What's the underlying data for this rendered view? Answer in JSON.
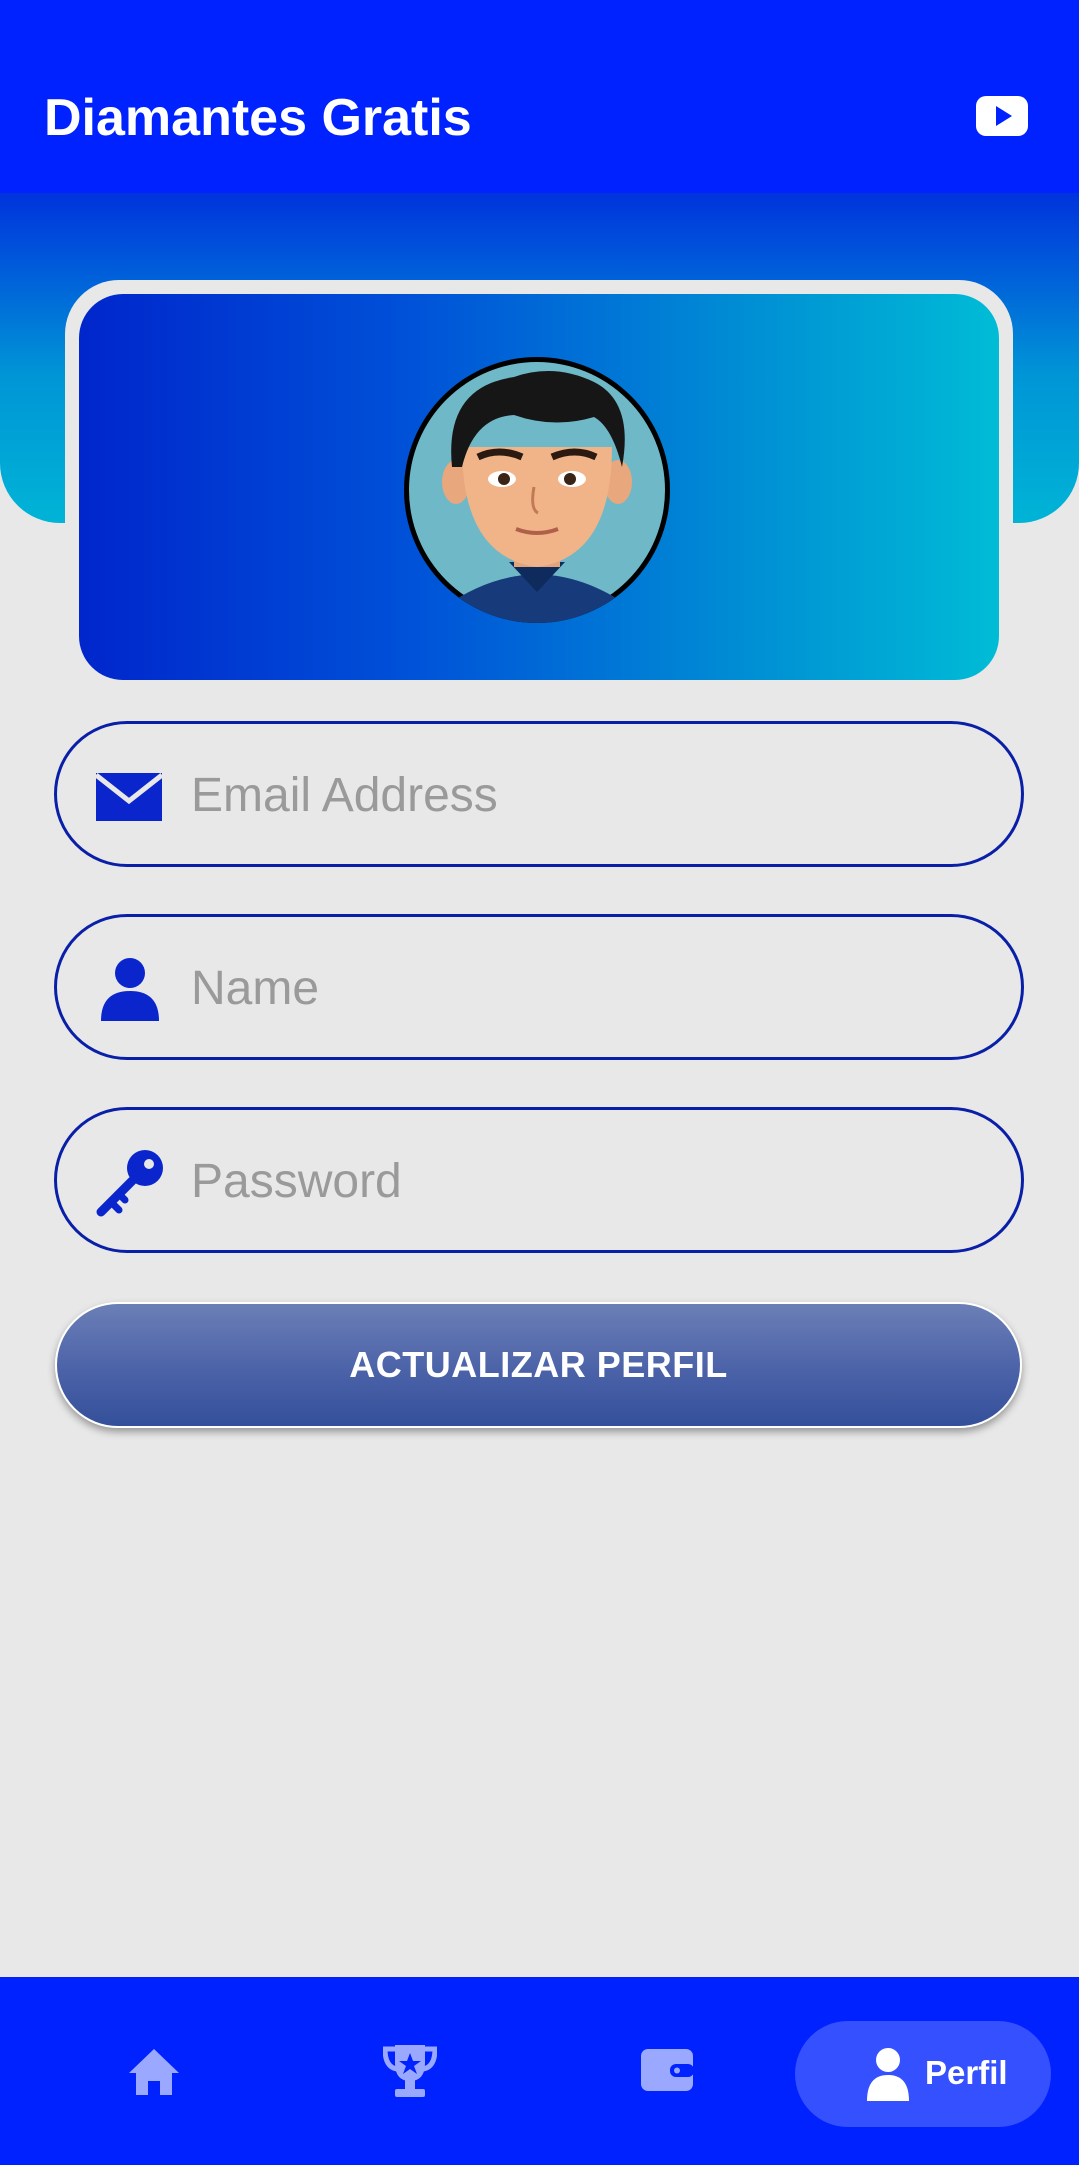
{
  "app": {
    "title": "Diamantes Gratis",
    "header_icon": "youtube-icon"
  },
  "profile": {
    "avatar_icon": "cartoon-avatar"
  },
  "form": {
    "email": {
      "placeholder": "Email Address",
      "value": "",
      "icon": "envelope-icon"
    },
    "name": {
      "placeholder": "Name",
      "value": "",
      "icon": "user-icon"
    },
    "password": {
      "placeholder": "Password",
      "value": "",
      "icon": "key-icon"
    },
    "submit_label": "ACTUALIZAR PERFIL"
  },
  "bottom_nav": {
    "items": [
      {
        "icon": "home-icon"
      },
      {
        "icon": "trophy-icon"
      },
      {
        "icon": "wallet-icon"
      },
      {
        "icon": "user-icon",
        "label": "Perfil",
        "active": true
      }
    ]
  },
  "colors": {
    "primary": "#0022ff",
    "field_border": "#0a1fa8",
    "button": "#4b62a8",
    "background": "#e8e8e8"
  }
}
